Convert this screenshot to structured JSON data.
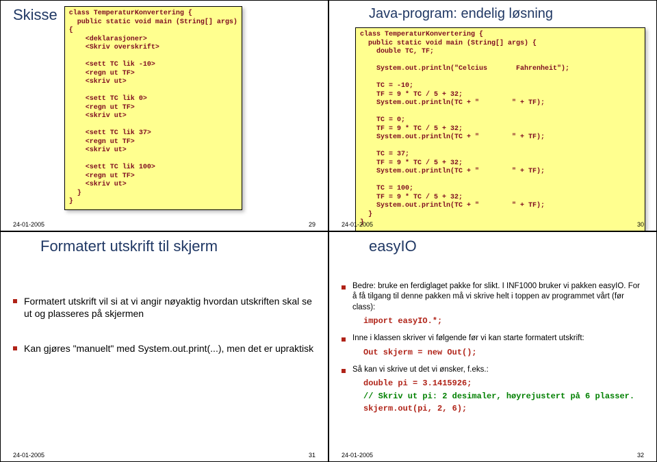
{
  "slide29": {
    "title": "Skisse",
    "code": "class TemperaturKonvertering {\n  public static void main (String[] args)\n{\n    <deklarasjoner>\n    <Skriv overskrift>\n\n    <sett TC lik -10>\n    <regn ut TF>\n    <skriv ut>\n\n    <sett TC lik 0>\n    <regn ut TF>\n    <skriv ut>\n\n    <sett TC lik 37>\n    <regn ut TF>\n    <skriv ut>\n\n    <sett TC lik 100>\n    <regn ut TF>\n    <skriv ut>\n  }\n}",
    "date": "24-01-2005",
    "num": "29"
  },
  "slide30": {
    "title": "Java-program: endelig løsning",
    "code": "class TemperaturKonvertering {\n  public static void main (String[] args) {\n    double TC, TF;\n\n    System.out.println(\"Celcius       Fahrenheit\");\n\n    TC = -10;\n    TF = 9 * TC / 5 + 32;\n    System.out.println(TC + \"        \" + TF);\n\n    TC = 0;\n    TF = 9 * TC / 5 + 32;\n    System.out.println(TC + \"        \" + TF);\n\n    TC = 37;\n    TF = 9 * TC / 5 + 32;\n    System.out.println(TC + \"        \" + TF);\n\n    TC = 100;\n    TF = 9 * TC / 5 + 32;\n    System.out.println(TC + \"        \" + TF);\n  }\n}",
    "date": "24-01-2005",
    "num": "30"
  },
  "slide31": {
    "title": "Formatert utskrift til skjerm",
    "b1": "Formatert utskrift vil si at vi angir nøyaktig hvordan utskriften skal se ut og plasseres på skjermen",
    "b2": "Kan gjøres \"manuelt\" med System.out.print(...), men det er upraktisk",
    "date": "24-01-2005",
    "num": "31"
  },
  "slide32": {
    "title": "easyIO",
    "b1": "Bedre: bruke en ferdiglaget pakke for slikt.  I INF1000 bruker vi pakken easyIO.  For å få tilgang til denne pakken må vi skrive helt i toppen av programmet vårt (før class):",
    "c1": "import easyIO.*;",
    "b2": "Inne i klassen skriver vi følgende før vi kan starte formatert utskrift:",
    "c2": "Out skjerm = new Out();",
    "b3": "Så kan vi skrive ut det vi ønsker, f.eks.:",
    "c3": "double pi = 3.1415926;",
    "c4": "// Skriv ut pi: 2 desimaler, høyrejustert på 6 plasser.",
    "c5": "skjerm.out(pi, 2, 6);",
    "date": "24-01-2005",
    "num": "32"
  }
}
